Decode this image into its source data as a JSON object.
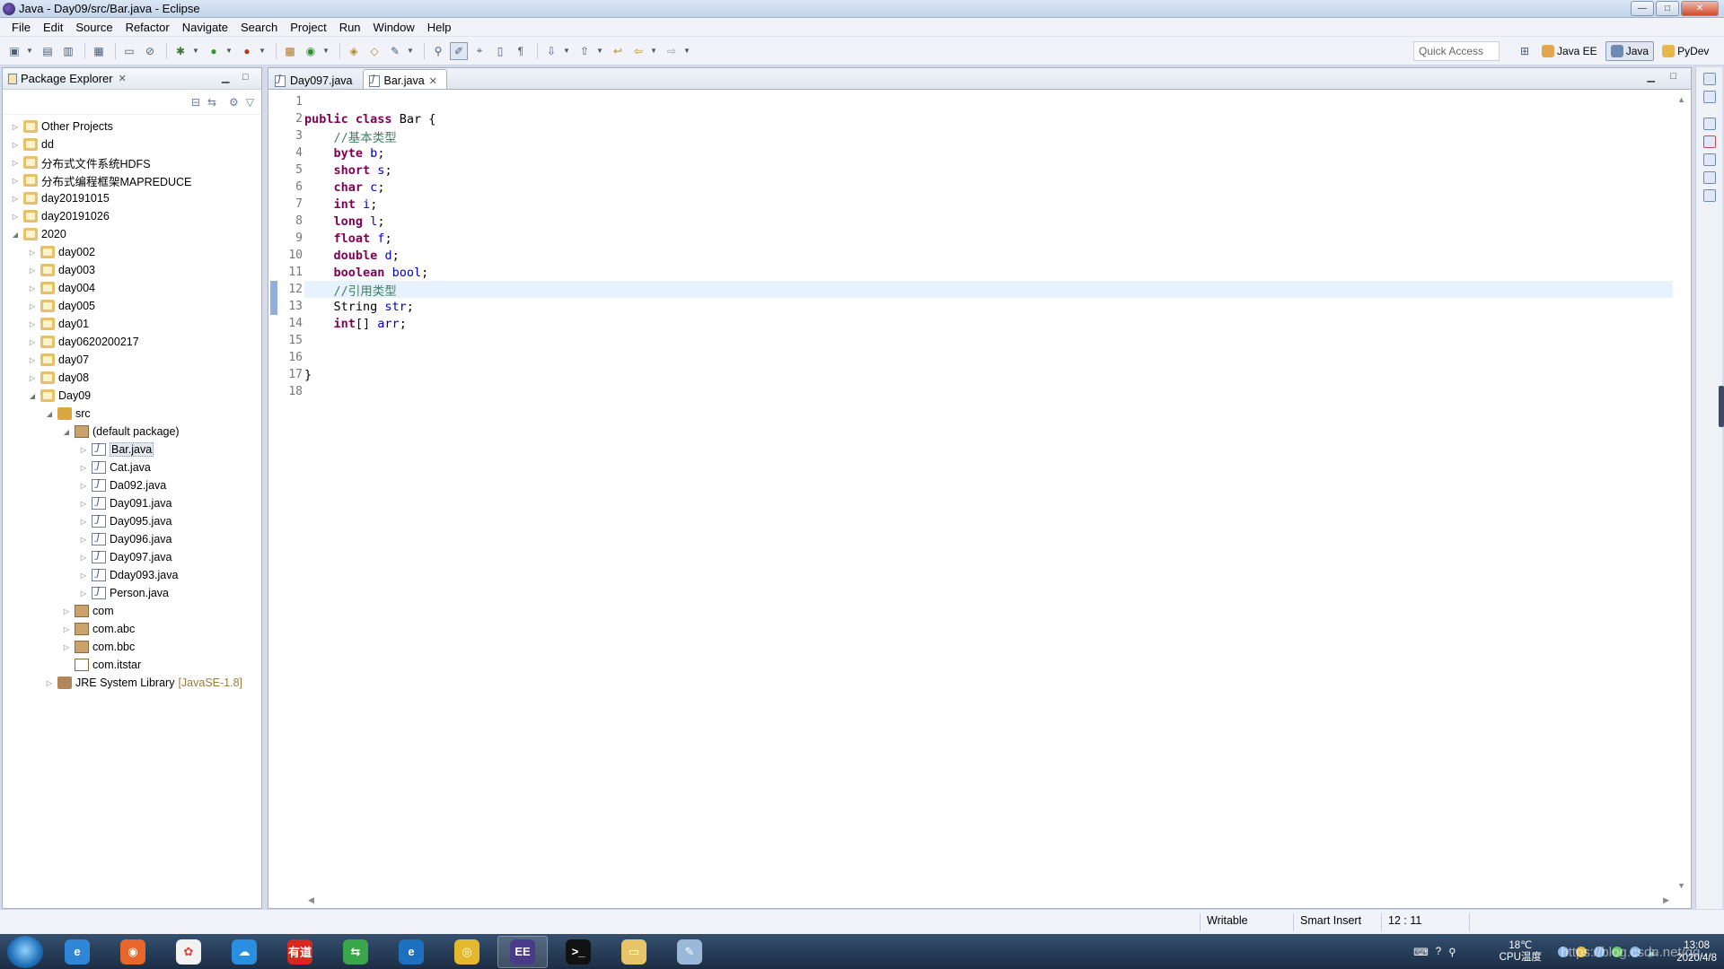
{
  "window": {
    "title": "Java - Day09/src/Bar.java - Eclipse",
    "controls": {
      "minimize": "—",
      "maximize": "□",
      "close": "✕"
    }
  },
  "menu": [
    "File",
    "Edit",
    "Source",
    "Refactor",
    "Navigate",
    "Search",
    "Project",
    "Run",
    "Window",
    "Help"
  ],
  "toolbar": {
    "quick_access_placeholder": "Quick Access",
    "perspectives": [
      {
        "label": "Java EE",
        "active": false,
        "color": "#e0a84a"
      },
      {
        "label": "Java",
        "active": true,
        "color": "#6f8ab5"
      },
      {
        "label": "PyDev",
        "active": false,
        "color": "#e6b84a"
      }
    ]
  },
  "explorer": {
    "title": "Package Explorer",
    "tree": [
      {
        "label": "Other Projects",
        "indent": 0,
        "twisty": "▷",
        "icon": "project-icon",
        "type": "project"
      },
      {
        "label": "dd",
        "indent": 0,
        "twisty": "▷",
        "icon": "project-icon",
        "type": "project"
      },
      {
        "label": "分布式文件系统HDFS",
        "indent": 0,
        "twisty": "▷",
        "icon": "project-icon",
        "type": "project"
      },
      {
        "label": "分布式编程框架MAPREDUCE",
        "indent": 0,
        "twisty": "▷",
        "icon": "project-icon",
        "type": "project"
      },
      {
        "label": "day20191015",
        "indent": 0,
        "twisty": "▷",
        "icon": "project-icon",
        "type": "project"
      },
      {
        "label": "day20191026",
        "indent": 0,
        "twisty": "▷",
        "icon": "project-icon",
        "type": "project"
      },
      {
        "label": "2020",
        "indent": 0,
        "twisty": "◢",
        "icon": "project-icon",
        "type": "project"
      },
      {
        "label": "day002",
        "indent": 1,
        "twisty": "▷",
        "icon": "project-icon",
        "type": "project"
      },
      {
        "label": "day003",
        "indent": 1,
        "twisty": "▷",
        "icon": "project-icon",
        "type": "project"
      },
      {
        "label": "day004",
        "indent": 1,
        "twisty": "▷",
        "icon": "project-icon",
        "type": "project"
      },
      {
        "label": "day005",
        "indent": 1,
        "twisty": "▷",
        "icon": "project-icon",
        "type": "project"
      },
      {
        "label": "day01",
        "indent": 1,
        "twisty": "▷",
        "icon": "project-icon",
        "type": "project"
      },
      {
        "label": "day0620200217",
        "indent": 1,
        "twisty": "▷",
        "icon": "project-icon",
        "type": "project"
      },
      {
        "label": "day07",
        "indent": 1,
        "twisty": "▷",
        "icon": "project-icon",
        "type": "project"
      },
      {
        "label": "day08",
        "indent": 1,
        "twisty": "▷",
        "icon": "project-icon",
        "type": "project"
      },
      {
        "label": "Day09",
        "indent": 1,
        "twisty": "◢",
        "icon": "project-icon",
        "type": "project"
      },
      {
        "label": "src",
        "indent": 2,
        "twisty": "◢",
        "icon": "source-folder-icon",
        "type": "src"
      },
      {
        "label": "(default package)",
        "indent": 3,
        "twisty": "◢",
        "icon": "package-icon",
        "type": "pkg"
      },
      {
        "label": "Bar.java",
        "indent": 4,
        "twisty": "▷",
        "icon": "java-file-icon",
        "type": "java",
        "selected": true
      },
      {
        "label": "Cat.java",
        "indent": 4,
        "twisty": "▷",
        "icon": "java-file-icon",
        "type": "java"
      },
      {
        "label": "Da092.java",
        "indent": 4,
        "twisty": "▷",
        "icon": "java-file-icon",
        "type": "java"
      },
      {
        "label": "Day091.java",
        "indent": 4,
        "twisty": "▷",
        "icon": "java-file-icon",
        "type": "java"
      },
      {
        "label": "Day095.java",
        "indent": 4,
        "twisty": "▷",
        "icon": "java-file-icon",
        "type": "java"
      },
      {
        "label": "Day096.java",
        "indent": 4,
        "twisty": "▷",
        "icon": "java-file-icon",
        "type": "java"
      },
      {
        "label": "Day097.java",
        "indent": 4,
        "twisty": "▷",
        "icon": "java-file-icon",
        "type": "java"
      },
      {
        "label": "Dday093.java",
        "indent": 4,
        "twisty": "▷",
        "icon": "java-file-icon",
        "type": "java"
      },
      {
        "label": "Person.java",
        "indent": 4,
        "twisty": "▷",
        "icon": "java-file-icon",
        "type": "java"
      },
      {
        "label": "com",
        "indent": 3,
        "twisty": "▷",
        "icon": "package-icon",
        "type": "pkg"
      },
      {
        "label": "com.abc",
        "indent": 3,
        "twisty": "▷",
        "icon": "package-icon",
        "type": "pkg"
      },
      {
        "label": "com.bbc",
        "indent": 3,
        "twisty": "▷",
        "icon": "package-icon",
        "type": "pkg"
      },
      {
        "label": "com.itstar",
        "indent": 3,
        "twisty": "",
        "icon": "empty-package-icon",
        "type": "pkg-empty"
      },
      {
        "label": "JRE System Library",
        "indent": 2,
        "twisty": "▷",
        "icon": "library-icon",
        "type": "lib",
        "decor": "[JavaSE-1.8]"
      }
    ]
  },
  "editor": {
    "tabs": [
      {
        "label": "Day097.java",
        "active": false
      },
      {
        "label": "Bar.java",
        "active": true
      }
    ],
    "current_line": 12,
    "lines": [
      [],
      [
        [
          "kw",
          "public"
        ],
        [
          "plain",
          " "
        ],
        [
          "kw",
          "class"
        ],
        [
          "plain",
          " Bar {"
        ]
      ],
      [
        [
          "plain",
          "    "
        ],
        [
          "comment",
          "//基本类型"
        ]
      ],
      [
        [
          "plain",
          "    "
        ],
        [
          "kw",
          "byte"
        ],
        [
          "plain",
          " "
        ],
        [
          "field",
          "b"
        ],
        [
          "plain",
          ";"
        ]
      ],
      [
        [
          "plain",
          "    "
        ],
        [
          "kw",
          "short"
        ],
        [
          "plain",
          " "
        ],
        [
          "field",
          "s"
        ],
        [
          "plain",
          ";"
        ]
      ],
      [
        [
          "plain",
          "    "
        ],
        [
          "kw",
          "char"
        ],
        [
          "plain",
          " "
        ],
        [
          "field",
          "c"
        ],
        [
          "plain",
          ";"
        ]
      ],
      [
        [
          "plain",
          "    "
        ],
        [
          "kw",
          "int"
        ],
        [
          "plain",
          " "
        ],
        [
          "field",
          "i"
        ],
        [
          "plain",
          ";"
        ]
      ],
      [
        [
          "plain",
          "    "
        ],
        [
          "kw",
          "long"
        ],
        [
          "plain",
          " "
        ],
        [
          "field",
          "l"
        ],
        [
          "plain",
          ";"
        ]
      ],
      [
        [
          "plain",
          "    "
        ],
        [
          "kw",
          "float"
        ],
        [
          "plain",
          " "
        ],
        [
          "field",
          "f"
        ],
        [
          "plain",
          ";"
        ]
      ],
      [
        [
          "plain",
          "    "
        ],
        [
          "kw",
          "double"
        ],
        [
          "plain",
          " "
        ],
        [
          "field",
          "d"
        ],
        [
          "plain",
          ";"
        ]
      ],
      [
        [
          "plain",
          "    "
        ],
        [
          "kw",
          "boolean"
        ],
        [
          "plain",
          " "
        ],
        [
          "field",
          "bool"
        ],
        [
          "plain",
          ";"
        ]
      ],
      [
        [
          "plain",
          "    "
        ],
        [
          "comment",
          "//引用类型"
        ]
      ],
      [
        [
          "plain",
          "    String "
        ],
        [
          "field",
          "str"
        ],
        [
          "plain",
          ";"
        ]
      ],
      [
        [
          "plain",
          "    "
        ],
        [
          "kw",
          "int"
        ],
        [
          "plain",
          "[] "
        ],
        [
          "field",
          "arr"
        ],
        [
          "plain",
          ";"
        ]
      ],
      [],
      [],
      [
        [
          "plain",
          "}"
        ]
      ],
      []
    ]
  },
  "status": {
    "writable": "Writable",
    "insert_mode": "Smart Insert",
    "position": "12 : 11"
  },
  "taskbar": {
    "apps": [
      {
        "name": "ie-icon",
        "color": "#2f86d6",
        "glyph": "e",
        "active": false
      },
      {
        "name": "firefox-icon",
        "color": "#e8662a",
        "glyph": "◉",
        "active": false
      },
      {
        "name": "photos-icon",
        "color": "#f2f2f2",
        "glyph": "✿",
        "active": false
      },
      {
        "name": "cloud-icon",
        "color": "#2a8fe0",
        "glyph": "☁",
        "active": false
      },
      {
        "name": "youdao-icon",
        "color": "#d8281e",
        "glyph": "有道",
        "active": false
      },
      {
        "name": "sync-icon",
        "color": "#3aa64a",
        "glyph": "⇆",
        "active": false
      },
      {
        "name": "ie-alt-icon",
        "color": "#1f6fc0",
        "glyph": "e",
        "active": false
      },
      {
        "name": "chrome-icon",
        "color": "#e4b82d",
        "glyph": "◎",
        "active": false
      },
      {
        "name": "eclipse-icon",
        "color": "#4a3a8a",
        "glyph": "EE",
        "active": true
      },
      {
        "name": "terminal-icon",
        "color": "#111111",
        "glyph": ">_",
        "active": false
      },
      {
        "name": "folder-icon",
        "color": "#e8c468",
        "glyph": "▭",
        "active": false
      },
      {
        "name": "notepad-icon",
        "color": "#9ab8d8",
        "glyph": "✎",
        "active": false
      }
    ],
    "temperature": "18℃",
    "temperature_label": "CPU温度",
    "time": "13:08",
    "date": "2020/4/8"
  },
  "watermark": "https://blog.csdn.net/qq..."
}
